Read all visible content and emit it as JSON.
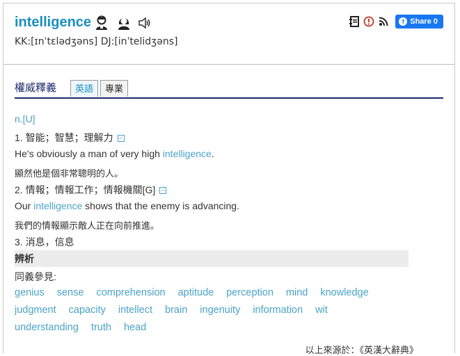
{
  "header": {
    "word": "intelligence",
    "phonetic": "KK:[ɪnˈtɛlədʒəns] DJ:[inˈtelidʒəns]",
    "share_label": "Share 0",
    "icons": [
      "male-voice-icon",
      "female-voice-icon",
      "speaker-icon",
      "notebook-icon",
      "report-icon",
      "rss-icon",
      "facebook-icon"
    ]
  },
  "tabs": {
    "title": "權威釋義",
    "items": [
      {
        "label": "英語",
        "active": true
      },
      {
        "label": "專業",
        "active": false
      }
    ]
  },
  "entry": {
    "pos": "n.[U]",
    "senses": [
      {
        "label": "1. 智能；智慧；理解力",
        "example_pre": "He's obviously a man of very high ",
        "example_kw": "intelligence",
        "example_post": ".",
        "translation": "顯然他是個非常聰明的人。"
      },
      {
        "label": "2. 情報；情報工作；情報機關[G]",
        "example_pre": "Our ",
        "example_kw": "intelligence",
        "example_post": " shows that the enemy is advancing.",
        "translation": "我們的情報顯示敵人正在向前推進。"
      },
      {
        "label": "3. 消息，信息"
      }
    ],
    "analysis_label": "辨析",
    "synonyms_label": "同義參見:",
    "synonyms": [
      [
        "genius",
        "sense",
        "comprehension",
        "aptitude",
        "perception",
        "mind",
        "knowledge"
      ],
      [
        "judgment",
        "capacity",
        "intellect",
        "brain",
        "ingenuity",
        "information",
        "wit"
      ],
      [
        "understanding",
        "truth",
        "head"
      ]
    ],
    "source": "以上來源於：《英漢大辭典》",
    "toggle_symbol": "−"
  }
}
